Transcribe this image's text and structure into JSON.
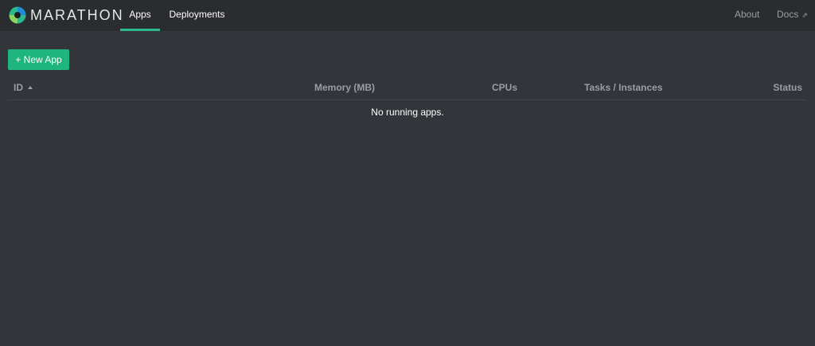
{
  "brand": {
    "name": "MARATHON"
  },
  "nav": {
    "tabs": [
      {
        "label": "Apps",
        "active": true
      },
      {
        "label": "Deployments",
        "active": false
      }
    ],
    "right": {
      "about_label": "About",
      "docs_label": "Docs"
    }
  },
  "toolbar": {
    "new_app_label": "+ New App"
  },
  "table": {
    "columns": [
      "ID",
      "Memory (MB)",
      "CPUs",
      "Tasks / Instances",
      "Status"
    ],
    "sort_column": "ID",
    "sort_direction": "ascending",
    "empty_message": "No running apps."
  },
  "colors": {
    "background": "#323539",
    "navbar": "#2a2c30",
    "accent": "#1fb57f",
    "muted_text": "#9a9ea3"
  }
}
